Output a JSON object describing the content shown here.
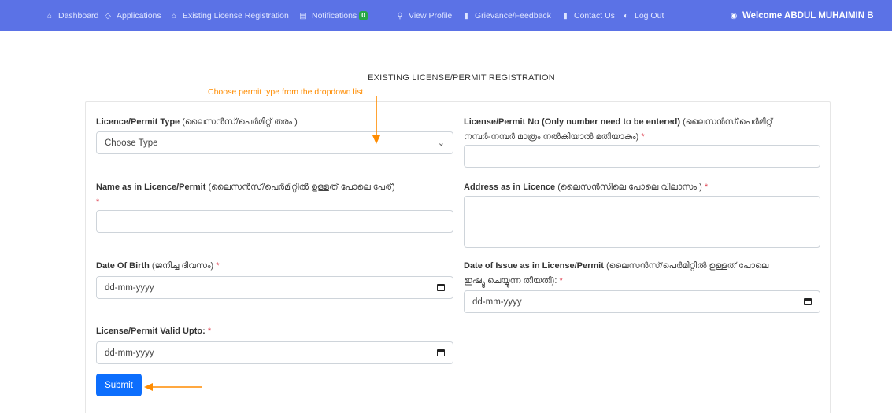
{
  "nav": {
    "dashboard": "Dashboard",
    "applications": "Applications",
    "existing_license_registration": "Existing License Registration",
    "notifications": "Notifications",
    "notifications_count": "0",
    "view_profile": "View Profile",
    "grievance_feedback": "Grievance/Feedback",
    "contact_us": "Contact Us",
    "log_out": "Log Out",
    "welcome": "Welcome ABDUL MUHAIMIN B"
  },
  "page": {
    "title": "EXISTING LICENSE/PERMIT REGISTRATION",
    "annotation_text": "Choose permit type from the dropdown list"
  },
  "form": {
    "permit_type": {
      "label": "Licence/Permit Type",
      "label_ml": "(ലൈസൻസ്/പെർമിറ്റ് തരം )",
      "value": "Choose Type"
    },
    "permit_no": {
      "label": "License/Permit No (Only number need to be entered)",
      "label_ml_1": "(ലൈസൻസ്/പെർമിറ്റ്",
      "label_ml_2": "നമ്പർ-നമ്പർ മാത്രം നൽകിയാൽ മതിയാകും)",
      "required": "*",
      "value": ""
    },
    "name": {
      "label": "Name as in Licence/Permit",
      "label_ml": "(ലൈസൻസ്/പെർമിറ്റിൽ ഉള്ളത് പോലെ പേര്)",
      "required": "*",
      "value": ""
    },
    "address": {
      "label": "Address as in Licence",
      "label_ml": "(ലൈസൻസിലെ പോലെ വിലാസം )",
      "required": "*",
      "value": ""
    },
    "dob": {
      "label": "Date Of Birth",
      "label_ml": "(ജനിച്ച ദിവസം)",
      "required": "*",
      "placeholder": "dd-mm-yyyy"
    },
    "date_of_issue": {
      "label": "Date of Issue as in License/Permit",
      "label_ml_1": "(ലൈസൻസ്/പെർമിറ്റിൽ ഉള്ളത് പോലെ",
      "label_ml_2": "ഇഷ്യൂ ചെയ്യുന്ന തീയതി):",
      "required": "*",
      "placeholder": "dd-mm-yyyy"
    },
    "valid_upto": {
      "label": "License/Permit Valid Upto:",
      "required": "*",
      "placeholder": "dd-mm-yyyy"
    },
    "submit_label": "Submit"
  },
  "colors": {
    "navbar": "#5b72e6",
    "accent": "#0d6efd",
    "annotation": "#ff8c00",
    "required": "#dc3545",
    "badge": "#28a745"
  }
}
